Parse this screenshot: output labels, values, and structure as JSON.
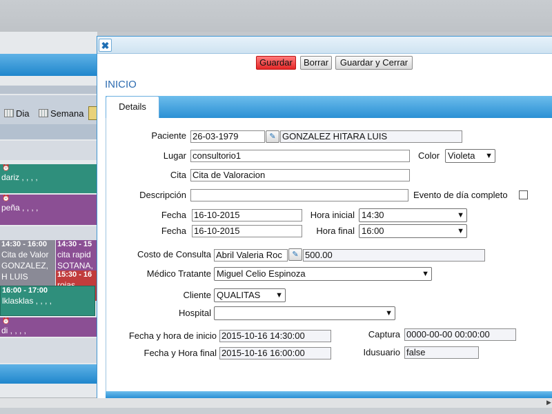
{
  "calendar": {
    "toolbar": {
      "day_label": "Dia",
      "week_label": "Semana"
    },
    "events": [
      {
        "text": "dariz , , , ,"
      },
      {
        "text": "peña , , , ,"
      },
      {
        "header": "14:30 - 16:00",
        "text": "Cita de Valor GONZALEZ, H LUIS"
      },
      {
        "header": "14:30 - 15",
        "text": "cita rapid SOTANA,"
      },
      {
        "header": "15:30 - 16",
        "text": "rojas , , ,"
      },
      {
        "header": "16:00 - 17:00",
        "text": "lklasklas , , , ,"
      },
      {
        "text": "di , , , ,"
      }
    ],
    "colors": {
      "teal": "#2f8f7c",
      "purple": "#8b4f94",
      "red": "#c13c3c",
      "grey": "#8a8a96"
    }
  },
  "dialog": {
    "buttons": {
      "save": "Guardar",
      "delete": "Borrar",
      "save_close": "Guardar y Cerrar"
    },
    "section_title": "INICIO",
    "tab_details": "Details",
    "form": {
      "paciente_label": "Paciente",
      "paciente_date": "26-03-1979",
      "paciente_name": "GONZALEZ HITARA LUIS",
      "lugar_label": "Lugar",
      "lugar_value": "consultorio1",
      "color_label": "Color",
      "color_value": "Violeta",
      "cita_label": "Cita",
      "cita_value": "Cita de Valoracion",
      "descripcion_label": "Descripción",
      "descripcion_value": "",
      "evento_label": "Evento de día completo",
      "fecha_label_1": "Fecha",
      "fecha_value_1": "16-10-2015",
      "hora_inicial_label": "Hora inicial",
      "hora_inicial_value": "14:30",
      "fecha_label_2": "Fecha",
      "fecha_value_2": "16-10-2015",
      "hora_final_label": "Hora final",
      "hora_final_value": "16:00",
      "costo_label": "Costo de Consulta",
      "costo_name": "Abril Valeria Roc",
      "costo_value": "500.00",
      "medico_label": "Médico Tratante",
      "medico_value": "Miguel Celio Espinoza",
      "cliente_label": "Cliente",
      "cliente_value": "QUALITAS",
      "hospital_label": "Hospital",
      "hospital_value": "",
      "fhi_label": "Fecha y hora de inicio",
      "fhi_value": "2015-10-16 14:30:00",
      "captura_label": "Captura",
      "captura_value": "0000-00-00 00:00:00",
      "fhf_label": "Fecha y Hora final",
      "fhf_value": "2015-10-16 16:00:00",
      "idusuario_label": "Idusuario",
      "idusuario_value": "false"
    },
    "accent": "#2a90d4"
  }
}
